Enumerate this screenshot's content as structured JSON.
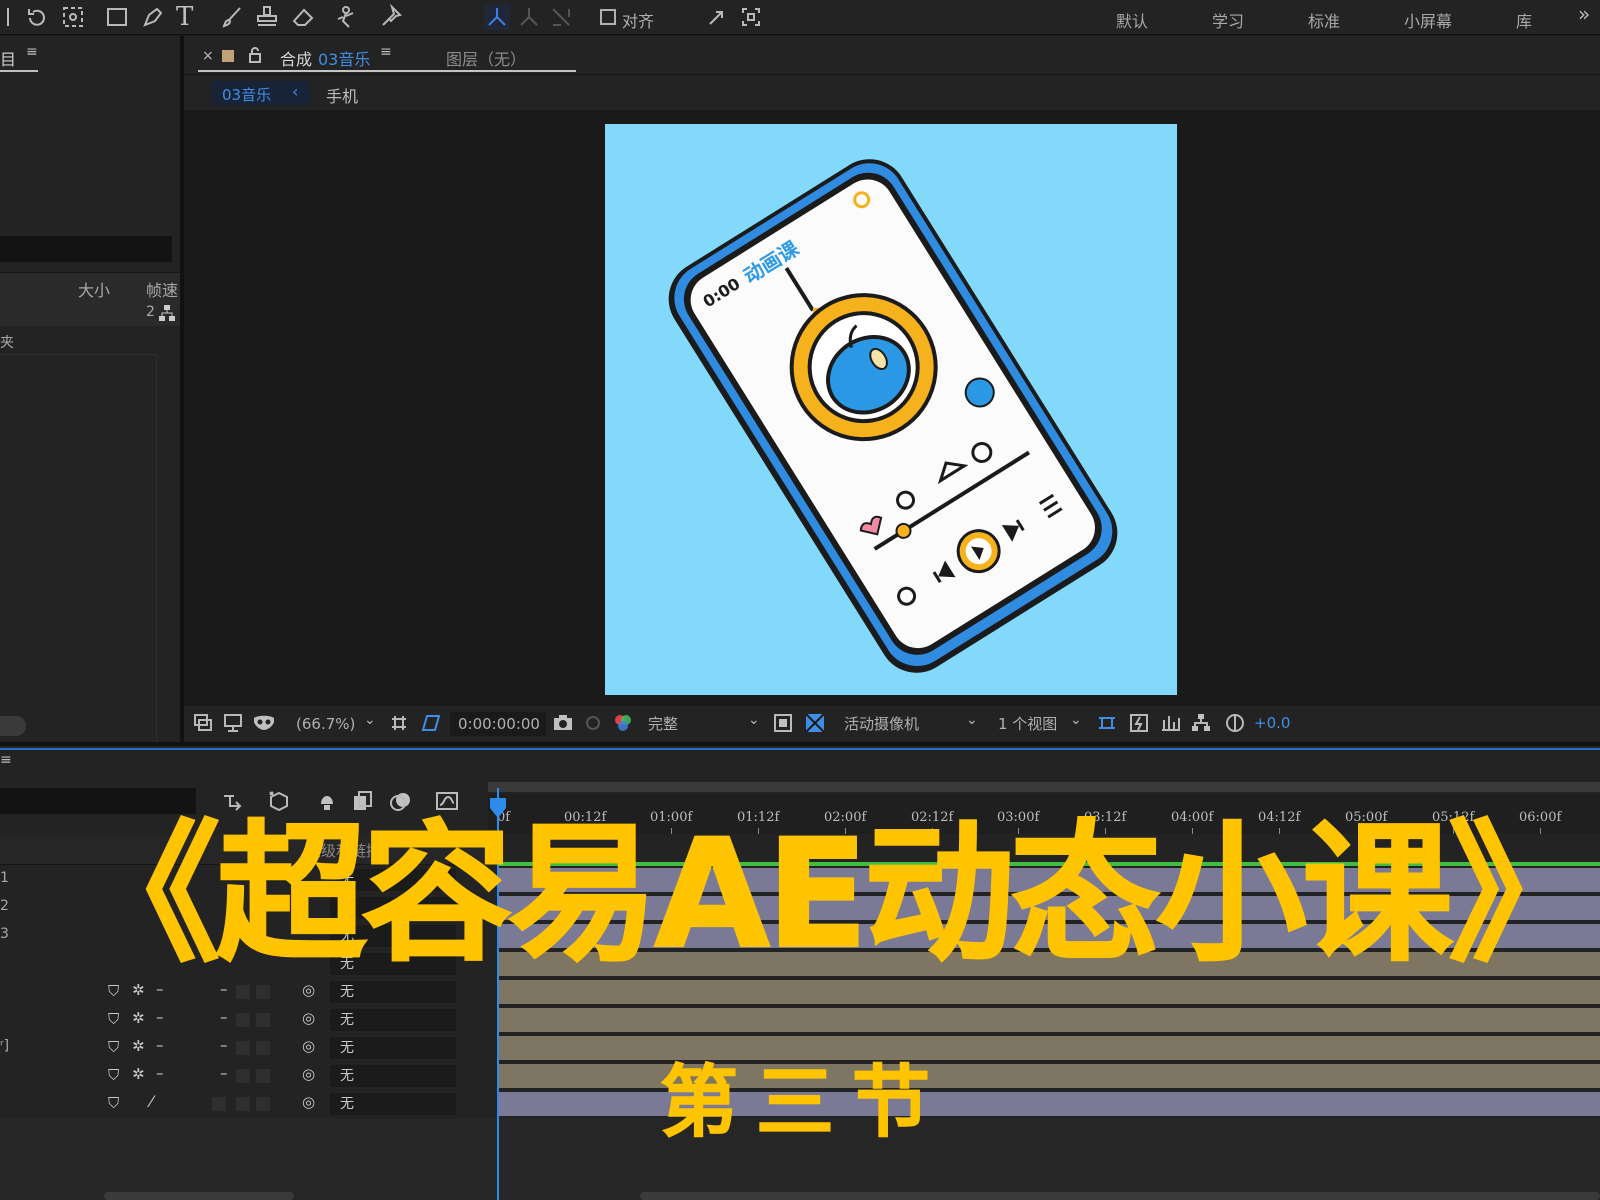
{
  "workspaces": [
    "默认",
    "学习",
    "标准",
    "小屏幕",
    "库"
  ],
  "toolbar": {
    "align_label": "对齐"
  },
  "project_panel": {
    "tab_fragment": "目",
    "col_size": "大小",
    "col_fps": "帧速",
    "row_value": "2",
    "folder_fragment": "夹"
  },
  "comp_panel": {
    "tab_prefix": "合成",
    "tab_comp_name": "03音乐",
    "layer_tab": "图层（无）",
    "breadcrumb_active": "03音乐",
    "breadcrumb_next": "手机"
  },
  "canvas_art": {
    "phone_text_time": "0:00",
    "phone_text_title": "动画课"
  },
  "viewer_bar": {
    "zoom": "(66.7%)",
    "timecode": "0:00:00:00",
    "resolution": "完整",
    "camera": "活动摄像机",
    "views": "1 个视图",
    "exposure": "+0.0"
  },
  "timeline": {
    "ruler_labels": [
      "0f",
      "00:12f",
      "01:00f",
      "01:12f",
      "02:00f",
      "02:12f",
      "03:00f",
      "03:12f",
      "04:00f",
      "04:12f",
      "05:00f",
      "05:12f",
      "06:00f"
    ],
    "parent_header": "父级和链接",
    "row_numbers": [
      "1",
      "2",
      "3"
    ],
    "row_fragment": "ʳ]",
    "parent_values": [
      "无",
      "无",
      "无",
      "无",
      "无",
      "无",
      "无",
      "无",
      "无"
    ]
  },
  "overlay": {
    "title": "《超容易AE动态小课》",
    "subtitle": "第三节"
  },
  "colors": {
    "canvas_bg": "#82d9fb",
    "accent_blue": "#2d8ceb",
    "overlay_yellow": "#ffc400",
    "track_tan": "#7e7563",
    "track_lavender": "#7a7a96"
  }
}
